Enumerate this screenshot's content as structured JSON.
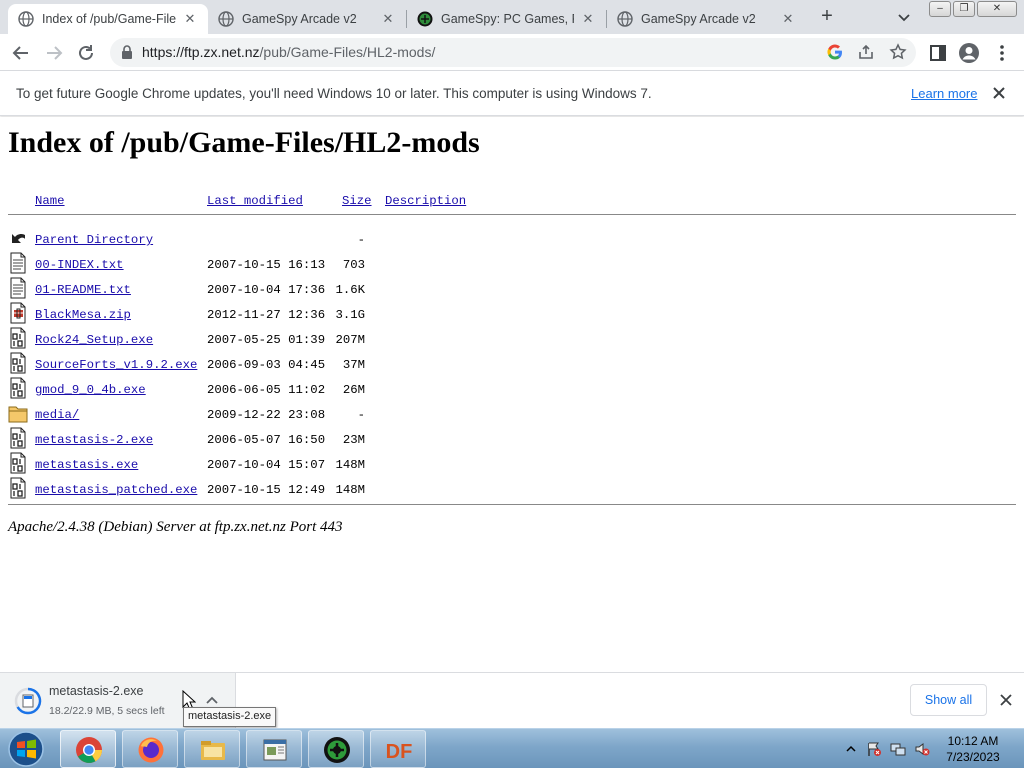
{
  "tabs": [
    {
      "title": "Index of /pub/Game-Files",
      "active": true
    },
    {
      "title": "GameSpy Arcade v2",
      "active": false
    },
    {
      "title": "GameSpy: PC Games, Rev",
      "active": false
    },
    {
      "title": "GameSpy Arcade v2",
      "active": false
    }
  ],
  "toolbar": {
    "url_host": "https://ftp.zx.net.nz",
    "url_path": "/pub/Game-Files/HL2-mods/"
  },
  "infobar": {
    "message": "To get future Google Chrome updates, you'll need Windows 10 or later. This computer is using Windows 7.",
    "learn_more": "Learn more"
  },
  "page": {
    "title": "Index of /pub/Game-Files/HL2-mods",
    "headers": {
      "name": "Name",
      "modified": "Last modified",
      "size": "Size",
      "description": "Description"
    },
    "rows": [
      {
        "icon": "back-icon",
        "name": "Parent Directory",
        "modified": "",
        "size": "-"
      },
      {
        "icon": "text-file-icon",
        "name": "00-INDEX.txt",
        "modified": "2007-10-15 16:13",
        "size": "703"
      },
      {
        "icon": "text-file-icon",
        "name": "01-README.txt",
        "modified": "2007-10-04 17:36",
        "size": "1.6K"
      },
      {
        "icon": "compressed-file-icon",
        "name": "BlackMesa.zip",
        "modified": "2012-11-27 12:36",
        "size": "3.1G"
      },
      {
        "icon": "binary-file-icon",
        "name": "Rock24_Setup.exe",
        "modified": "2007-05-25 01:39",
        "size": "207M"
      },
      {
        "icon": "binary-file-icon",
        "name": "SourceForts_v1.9.2.exe",
        "modified": "2006-09-03 04:45",
        "size": "37M"
      },
      {
        "icon": "binary-file-icon",
        "name": "gmod_9_0_4b.exe",
        "modified": "2006-06-05 11:02",
        "size": "26M"
      },
      {
        "icon": "folder-icon",
        "name": "media/",
        "modified": "2009-12-22 23:08",
        "size": "-"
      },
      {
        "icon": "binary-file-icon",
        "name": "metastasis-2.exe",
        "modified": "2006-05-07 16:50",
        "size": "23M"
      },
      {
        "icon": "binary-file-icon",
        "name": "metastasis.exe",
        "modified": "2007-10-04 15:07",
        "size": "148M"
      },
      {
        "icon": "binary-file-icon",
        "name": "metastasis_patched.exe",
        "modified": "2007-10-15 12:49",
        "size": "148M"
      }
    ],
    "footer": "Apache/2.4.38 (Debian) Server at ftp.zx.net.nz Port 443"
  },
  "download": {
    "filename": "metastasis-2.exe",
    "status": "18.2/22.9 MB, 5 secs left",
    "tooltip": "metastasis-2.exe",
    "show_all": "Show all"
  },
  "taskbar": {
    "apps": [
      "chrome-icon",
      "firefox-icon",
      "file-explorer-icon",
      "document-viewer-icon",
      "gamespy-icon",
      "df-icon"
    ],
    "df_label": "DF",
    "time": "10:12 AM",
    "date": "7/23/2023"
  },
  "colors": {
    "link": "#1a0dab",
    "chrome_blue": "#1a73e8",
    "tabstrip": "#dee1e6"
  }
}
